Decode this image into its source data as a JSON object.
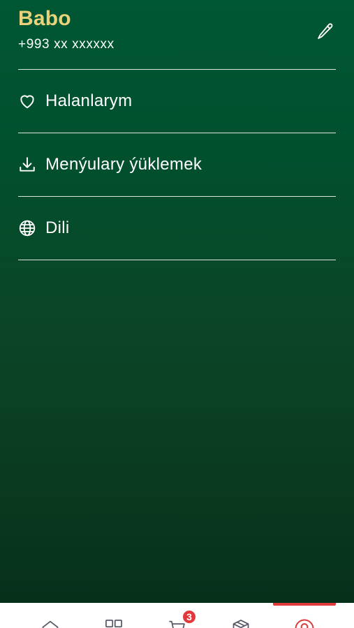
{
  "profile": {
    "name": "Babo",
    "phone": "+993 xx xxxxxx"
  },
  "menu": {
    "items": [
      {
        "label": "Halanlarym",
        "icon": "heart-icon"
      },
      {
        "label": "Menýulary ýüklemek",
        "icon": "download-icon"
      },
      {
        "label": "Dili",
        "icon": "globe-icon"
      }
    ]
  },
  "tabbar": {
    "items": [
      {
        "icon": "home-icon"
      },
      {
        "icon": "grid-icon"
      },
      {
        "icon": "cart-icon",
        "badge": "3"
      },
      {
        "icon": "box-icon"
      },
      {
        "icon": "profile-icon",
        "active": true
      }
    ]
  },
  "colors": {
    "accent_name": "#e9d27a",
    "active_tab": "#e03a3a",
    "badge": "#e3383b",
    "background_top": "#005733",
    "background_bottom": "#07301b"
  }
}
